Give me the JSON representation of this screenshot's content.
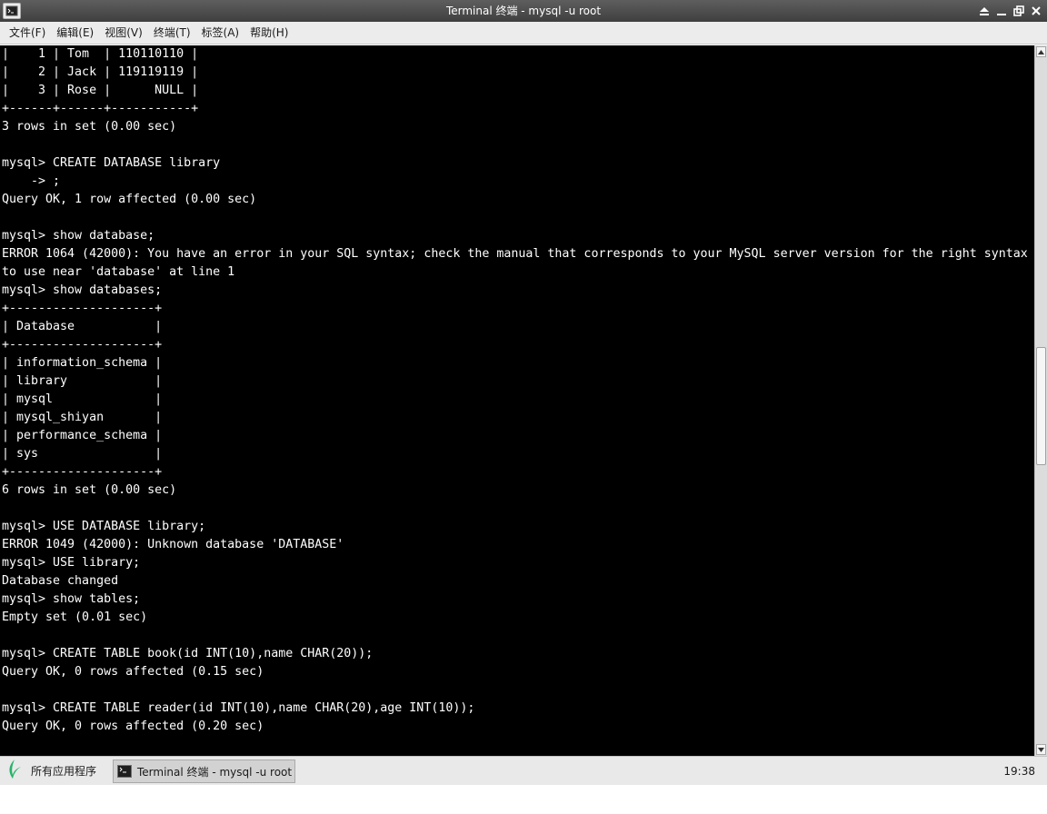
{
  "window": {
    "title": "Terminal 终端 - mysql -u root",
    "controls": {
      "shade": "⏶",
      "minimize": "_",
      "maximize": "🗗",
      "close": "✕"
    }
  },
  "menubar": {
    "items": [
      {
        "label": "文件(F)"
      },
      {
        "label": "编辑(E)"
      },
      {
        "label": "视图(V)"
      },
      {
        "label": "终端(T)"
      },
      {
        "label": "标签(A)"
      },
      {
        "label": "帮助(H)"
      }
    ]
  },
  "terminal": {
    "background": "#000000",
    "foreground": "#ffffff",
    "lines": [
      "|    1 | Tom  | 110110110 |",
      "|    2 | Jack | 119119119 |",
      "|    3 | Rose |      NULL |",
      "+------+------+-----------+",
      "3 rows in set (0.00 sec)",
      "",
      "mysql> CREATE DATABASE library",
      "    -> ;",
      "Query OK, 1 row affected (0.00 sec)",
      "",
      "mysql> show database;",
      "ERROR 1064 (42000): You have an error in your SQL syntax; check the manual that corresponds to your MySQL server version for the right syntax",
      "to use near 'database' at line 1",
      "mysql> show databases;",
      "+--------------------+",
      "| Database           |",
      "+--------------------+",
      "| information_schema |",
      "| library            |",
      "| mysql              |",
      "| mysql_shiyan       |",
      "| performance_schema |",
      "| sys                |",
      "+--------------------+",
      "6 rows in set (0.00 sec)",
      "",
      "mysql> USE DATABASE library;",
      "ERROR 1049 (42000): Unknown database 'DATABASE'",
      "mysql> USE library;",
      "Database changed",
      "mysql> show tables;",
      "Empty set (0.01 sec)",
      "",
      "mysql> CREATE TABLE book(id INT(10),name CHAR(20));",
      "Query OK, 0 rows affected (0.15 sec)",
      "",
      "mysql> CREATE TABLE reader(id INT(10),name CHAR(20),age INT(10));",
      "Query OK, 0 rows affected (0.20 sec)"
    ]
  },
  "scrollbar": {
    "position_fraction": 0.51
  },
  "taskbar": {
    "start_label": "所有应用程序",
    "task_label": "Terminal 终端 - mysql -u root",
    "clock": "19:38"
  }
}
